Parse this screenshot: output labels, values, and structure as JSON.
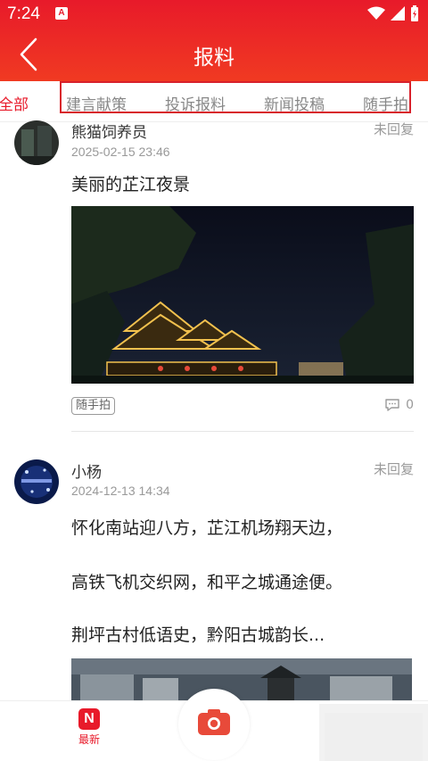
{
  "status_bar": {
    "time": "7:24",
    "notification_icon": "A"
  },
  "header": {
    "title": "报料",
    "back_icon": "chevron-left-icon"
  },
  "tabs": [
    {
      "label": "全部",
      "active": true
    },
    {
      "label": "建言献策",
      "active": false
    },
    {
      "label": "投诉报料",
      "active": false
    },
    {
      "label": "新闻投稿",
      "active": false
    },
    {
      "label": "随手拍",
      "active": false
    }
  ],
  "posts": [
    {
      "author": "熊猫饲养员",
      "status": "未回复",
      "time": "2025-02-15 23:46",
      "content": "美丽的芷江夜景",
      "tag": "随手拍",
      "comment_count": "0"
    },
    {
      "author": "小杨",
      "status": "未回复",
      "time": "2024-12-13 14:34",
      "content_lines": [
        "怀化南站迎八方，芷江机场翔天边，",
        "",
        "高铁飞机交织网，和平之城通途便。",
        "",
        "荆坪古村低语史，黔阳古城韵长..."
      ]
    }
  ],
  "bottom_nav": {
    "latest_label": "最新",
    "latest_icon_letter": "N"
  },
  "colors": {
    "accent": "#e81a2a",
    "header_bottom": "#f03a22",
    "muted": "#999999"
  }
}
